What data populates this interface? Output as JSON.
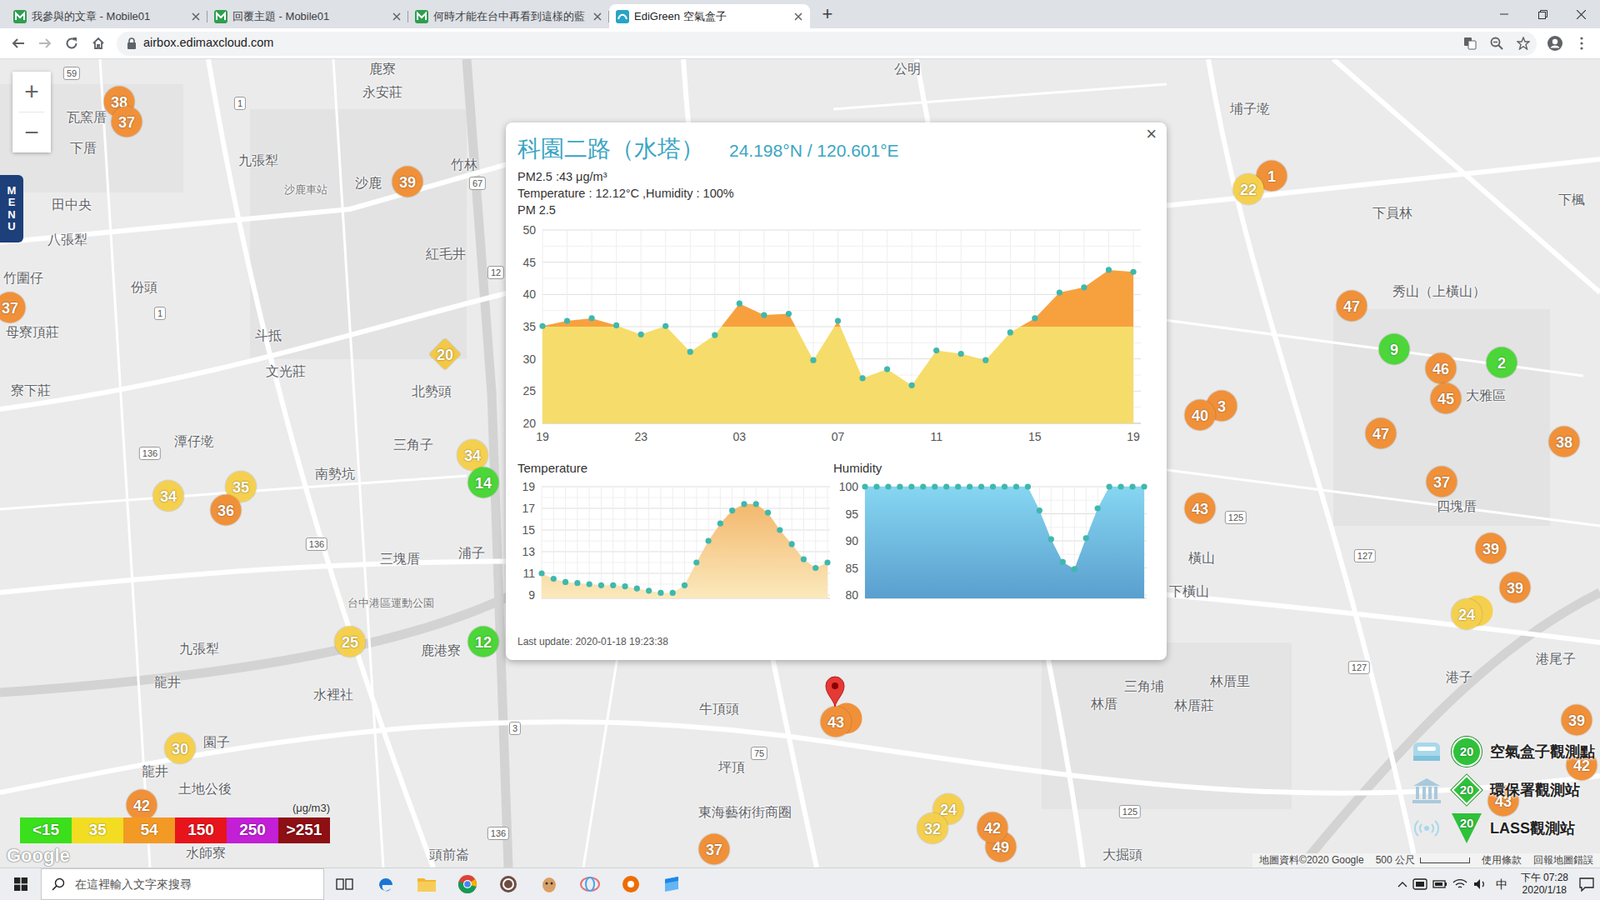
{
  "browser": {
    "tabs": [
      {
        "label": "我參與的文章 - Mobile01",
        "selected": false
      },
      {
        "label": "回覆主題 - Mobile01",
        "selected": false
      },
      {
        "label": "何時才能在台中再看到這樣的藍",
        "selected": false
      },
      {
        "label": "EdiGreen 空氣盒子",
        "selected": true
      }
    ],
    "new_tab": "+",
    "address": "airbox.edimaxcloud.com"
  },
  "map": {
    "zoom_in": "+",
    "zoom_out": "−",
    "menu": "MENU",
    "places": [
      {
        "name": "鹿寮",
        "kind": "town"
      },
      {
        "name": "永安莊",
        "kind": "town"
      },
      {
        "name": "公明",
        "kind": "town"
      },
      {
        "name": "埔子墘",
        "kind": "town"
      },
      {
        "name": "瓦窯厝",
        "kind": "town"
      },
      {
        "name": "下厝",
        "kind": "town"
      },
      {
        "name": "九張犁",
        "kind": "town"
      },
      {
        "name": "竹林",
        "kind": "town"
      },
      {
        "name": "沙鹿",
        "kind": "town"
      },
      {
        "name": "沙鹿車站",
        "kind": "poi"
      },
      {
        "name": "田中央",
        "kind": "town"
      },
      {
        "name": "下員林",
        "kind": "town"
      },
      {
        "name": "下楓",
        "kind": "town"
      },
      {
        "name": "八張犁",
        "kind": "town"
      },
      {
        "name": "紅毛井",
        "kind": "town"
      },
      {
        "name": "竹圍仔",
        "kind": "town"
      },
      {
        "name": "份頭",
        "kind": "town"
      },
      {
        "name": "秀山（上橫山）",
        "kind": "town"
      },
      {
        "name": "母寮頂莊",
        "kind": "town"
      },
      {
        "name": "斗抵",
        "kind": "town"
      },
      {
        "name": "文光莊",
        "kind": "town"
      },
      {
        "name": "北勢頭",
        "kind": "town"
      },
      {
        "name": "寮下莊",
        "kind": "town"
      },
      {
        "name": "大雅區",
        "kind": "town"
      },
      {
        "name": "潭仔墘",
        "kind": "town"
      },
      {
        "name": "三角子",
        "kind": "town"
      },
      {
        "name": "南勢坑",
        "kind": "town"
      },
      {
        "name": "四塊厝",
        "kind": "town"
      },
      {
        "name": "浦子",
        "kind": "town"
      },
      {
        "name": "三塊厝",
        "kind": "town"
      },
      {
        "name": "橫山",
        "kind": "town"
      },
      {
        "name": "下橫山",
        "kind": "town"
      },
      {
        "name": "台中港區運動公園",
        "kind": "poi"
      },
      {
        "name": "九張犁",
        "kind": "town"
      },
      {
        "name": "鹿港寮",
        "kind": "town"
      },
      {
        "name": "港尾子",
        "kind": "town"
      },
      {
        "name": "港子",
        "kind": "town"
      },
      {
        "name": "林厝里",
        "kind": "town"
      },
      {
        "name": "龍井",
        "kind": "town"
      },
      {
        "name": "三角埔",
        "kind": "town"
      },
      {
        "name": "水裡社",
        "kind": "town"
      },
      {
        "name": "林厝",
        "kind": "town"
      },
      {
        "name": "林厝莊",
        "kind": "town"
      },
      {
        "name": "牛頂頭",
        "kind": "town"
      },
      {
        "name": "園子",
        "kind": "town"
      },
      {
        "name": "坪頂",
        "kind": "town"
      },
      {
        "name": "龍井",
        "kind": "town"
      },
      {
        "name": "土地公後",
        "kind": "town"
      },
      {
        "name": "東海藝術街商圈",
        "kind": "town"
      },
      {
        "name": "水師寮",
        "kind": "town"
      },
      {
        "name": "頭前崙",
        "kind": "town"
      },
      {
        "name": "大掘頭",
        "kind": "town"
      }
    ],
    "routes": [
      "59",
      "1",
      "67",
      "12",
      "1",
      "136",
      "136",
      "3",
      "75",
      "136",
      "125",
      "127",
      "127",
      "125"
    ],
    "pins": [
      {
        "value": "38",
        "kind": "airbox",
        "color": "#f0913a",
        "stacked": false
      },
      {
        "value": "37",
        "kind": "airbox",
        "color": "#f0913a",
        "stacked": false
      },
      {
        "value": "39",
        "kind": "airbox",
        "color": "#f0913a",
        "stacked": false
      },
      {
        "value": "37",
        "kind": "airbox",
        "color": "#f0913a",
        "stacked": false
      },
      {
        "value": "20",
        "kind": "epa",
        "color": "#f3c843",
        "stacked": false
      },
      {
        "value": "34",
        "kind": "airbox",
        "color": "#f5d04f",
        "stacked": false
      },
      {
        "value": "14",
        "kind": "airbox",
        "color": "#4cd639",
        "stacked": false
      },
      {
        "value": "35",
        "kind": "airbox",
        "color": "#f5d04f",
        "stacked": false
      },
      {
        "value": "34",
        "kind": "airbox",
        "color": "#f5d04f",
        "stacked": false
      },
      {
        "value": "36",
        "kind": "airbox",
        "color": "#f0913a",
        "stacked": false
      },
      {
        "value": "25",
        "kind": "airbox",
        "color": "#f5d04f",
        "stacked": false
      },
      {
        "value": "12",
        "kind": "airbox",
        "color": "#4cd639",
        "stacked": false
      },
      {
        "value": "30",
        "kind": "airbox",
        "color": "#f5d04f",
        "stacked": false
      },
      {
        "value": "42",
        "kind": "airbox",
        "color": "#f0913a",
        "stacked": false
      },
      {
        "value": "37",
        "kind": "airbox",
        "color": "#f0913a",
        "stacked": false
      },
      {
        "value": "43",
        "kind": "airbox",
        "color": "#f0913a",
        "stacked": true
      },
      {
        "value": "24",
        "kind": "airbox",
        "color": "#f5d04f",
        "stacked": false
      },
      {
        "value": "32",
        "kind": "airbox",
        "color": "#f5d04f",
        "stacked": false
      },
      {
        "value": "49",
        "kind": "airbox",
        "color": "#f0913a",
        "stacked": false
      },
      {
        "value": "42",
        "kind": "airbox",
        "color": "#f0913a",
        "stacked": false
      },
      {
        "value": "1",
        "kind": "airbox",
        "color": "#f0913a",
        "stacked": false
      },
      {
        "value": "22",
        "kind": "airbox",
        "color": "#f5d04f",
        "stacked": false
      },
      {
        "value": "47",
        "kind": "airbox",
        "color": "#f0913a",
        "stacked": false
      },
      {
        "value": "9",
        "kind": "airbox",
        "color": "#4cd639",
        "stacked": false
      },
      {
        "value": "2",
        "kind": "airbox",
        "color": "#4cd639",
        "stacked": false
      },
      {
        "value": "46",
        "kind": "airbox",
        "color": "#f0913a",
        "stacked": false
      },
      {
        "value": "45",
        "kind": "airbox",
        "color": "#f0913a",
        "stacked": false
      },
      {
        "value": "3",
        "kind": "airbox",
        "color": "#f0913a",
        "stacked": false
      },
      {
        "value": "40",
        "kind": "airbox",
        "color": "#f0913a",
        "stacked": false
      },
      {
        "value": "47",
        "kind": "airbox",
        "color": "#f0913a",
        "stacked": false
      },
      {
        "value": "38",
        "kind": "airbox",
        "color": "#f0913a",
        "stacked": false
      },
      {
        "value": "37",
        "kind": "airbox",
        "color": "#f0913a",
        "stacked": false
      },
      {
        "value": "43",
        "kind": "airbox",
        "color": "#f0913a",
        "stacked": false
      },
      {
        "value": "39",
        "kind": "airbox",
        "color": "#f0913a",
        "stacked": false
      },
      {
        "value": "39",
        "kind": "airbox",
        "color": "#f0913a",
        "stacked": false
      },
      {
        "value": "24",
        "kind": "airbox",
        "color": "#f5d04f",
        "stacked": true
      },
      {
        "value": "39",
        "kind": "airbox",
        "color": "#f0913a",
        "stacked": false
      },
      {
        "value": "42",
        "kind": "airbox",
        "color": "#f0913a",
        "stacked": false
      },
      {
        "value": "43",
        "kind": "airbox",
        "color": "#f0913a",
        "stacked": false
      }
    ],
    "scale_legend": {
      "unit": "(μg/m3)",
      "steps": [
        {
          "label": "<15",
          "color": "#3be01c"
        },
        {
          "label": "35",
          "color": "#f2dd22"
        },
        {
          "label": "54",
          "color": "#f39a25"
        },
        {
          "label": "150",
          "color": "#e8141c"
        },
        {
          "label": "250",
          "color": "#c21fd6"
        },
        {
          "label": ">251",
          "color": "#8e0f14"
        }
      ]
    },
    "station_legend": [
      {
        "value": "20",
        "label": "空氣盒子觀測點",
        "kind": "airbox"
      },
      {
        "value": "20",
        "label": "環保署觀測站",
        "kind": "epa"
      },
      {
        "value": "20",
        "label": "LASS觀測站",
        "kind": "lass"
      }
    ],
    "google": "Google",
    "footer": {
      "attribution": "地圖資料©2020 Google",
      "scale": "500 公尺",
      "terms": "使用條款",
      "report": "回報地圖錯誤"
    }
  },
  "popup": {
    "title": "科園二路（水塔）",
    "coords": "24.198°N / 120.601°E",
    "close": "×",
    "pm_reading": "PM2.5 :43 μg/m³",
    "env_reading": "Temperature : 12.12°C ,Humidity : 100%",
    "pm_chart": {
      "title": "PM 2.5",
      "y_ticks": [
        "50",
        "45",
        "40",
        "35",
        "30",
        "25",
        "20"
      ],
      "x_ticks": [
        "19",
        "23",
        "03",
        "07",
        "11",
        "15",
        "19"
      ],
      "values": [
        35.1,
        35.9,
        36.3,
        35.2,
        33.8,
        35.1,
        31.1,
        33.7,
        38.6,
        36.8,
        37,
        29.8,
        35.9,
        27,
        28.4,
        25.9,
        31.3,
        30.8,
        29.8,
        34.1,
        36.3,
        40.3,
        41.1,
        43.8,
        43.5
      ]
    },
    "temperature_chart": {
      "title": "Temperature",
      "y_ticks": [
        "19",
        "17",
        "15",
        "13",
        "11",
        "9"
      ],
      "values": [
        11,
        10.5,
        10.2,
        10.1,
        10,
        9.9,
        9.9,
        9.8,
        9.6,
        9.4,
        9.2,
        9.2,
        9.9,
        12,
        14,
        15.6,
        16.8,
        17.4,
        17.4,
        16.6,
        15,
        13.7,
        12.3,
        11.5,
        12
      ]
    },
    "humidity_chart": {
      "title": "Humidity",
      "y_ticks": [
        "100",
        "95",
        "90",
        "85",
        "80"
      ],
      "values": [
        100,
        100,
        100,
        100,
        100,
        100,
        100,
        100,
        100,
        100,
        100,
        100,
        100,
        100,
        100,
        95.6,
        90.3,
        86.1,
        84.8,
        90.5,
        96,
        100,
        100,
        100,
        100
      ]
    },
    "last_update": "Last update: 2020-01-18 19:23:38"
  },
  "taskbar": {
    "search_placeholder": "在這裡輸入文字來搜尋",
    "ime": "中",
    "time": "下午 07:28",
    "date": "2020/1/18"
  }
}
